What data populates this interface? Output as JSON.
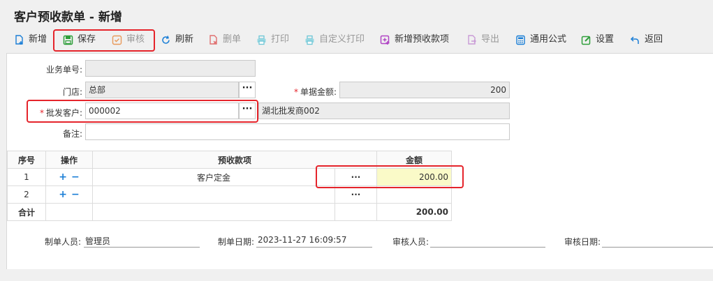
{
  "page": {
    "title": "客户预收款单 - 新增"
  },
  "toolbar": {
    "new": "新增",
    "save": "保存",
    "audit": "审核",
    "refresh": "刷新",
    "delete": "删单",
    "print": "打印",
    "custom_print": "自定义打印",
    "new_item": "新增预收款项",
    "export": "导出",
    "formula": "通用公式",
    "settings": "设置",
    "back": "返回"
  },
  "form": {
    "biz_no_label": "业务单号:",
    "biz_no_value": "",
    "store_label": "门店:",
    "store_value": "总部",
    "amount_label": "单据金额:",
    "amount_value": "200",
    "customer_label": "批发客户:",
    "customer_code": "000002",
    "customer_name": "湖北批发商002",
    "remark_label": "备注:",
    "remark_value": "",
    "required_mark": "*",
    "dots": "···"
  },
  "table": {
    "headers": {
      "seq": "序号",
      "op": "操作",
      "item": "预收款项",
      "amount": "金额"
    },
    "rows": [
      {
        "seq": "1",
        "item": "客户定金",
        "amount": "200.00"
      },
      {
        "seq": "2",
        "item": "",
        "amount": ""
      }
    ],
    "op_plus": "+",
    "op_minus": "−",
    "total_label": "合计",
    "total_value": "200.00"
  },
  "footer": {
    "maker_label": "制单人员:",
    "maker_value": "管理员",
    "date_label": "制单日期:",
    "date_value": "2023-11-27 16:09:57",
    "auditor_label": "审核人员:",
    "auditor_value": "",
    "audit_date_label": "审核日期:",
    "audit_date_value": ""
  },
  "colors": {
    "highlight": "#e5242b",
    "link_blue": "#1a7ed6",
    "readonly_bg": "#ececec",
    "amount_bg": "#fafac8"
  }
}
